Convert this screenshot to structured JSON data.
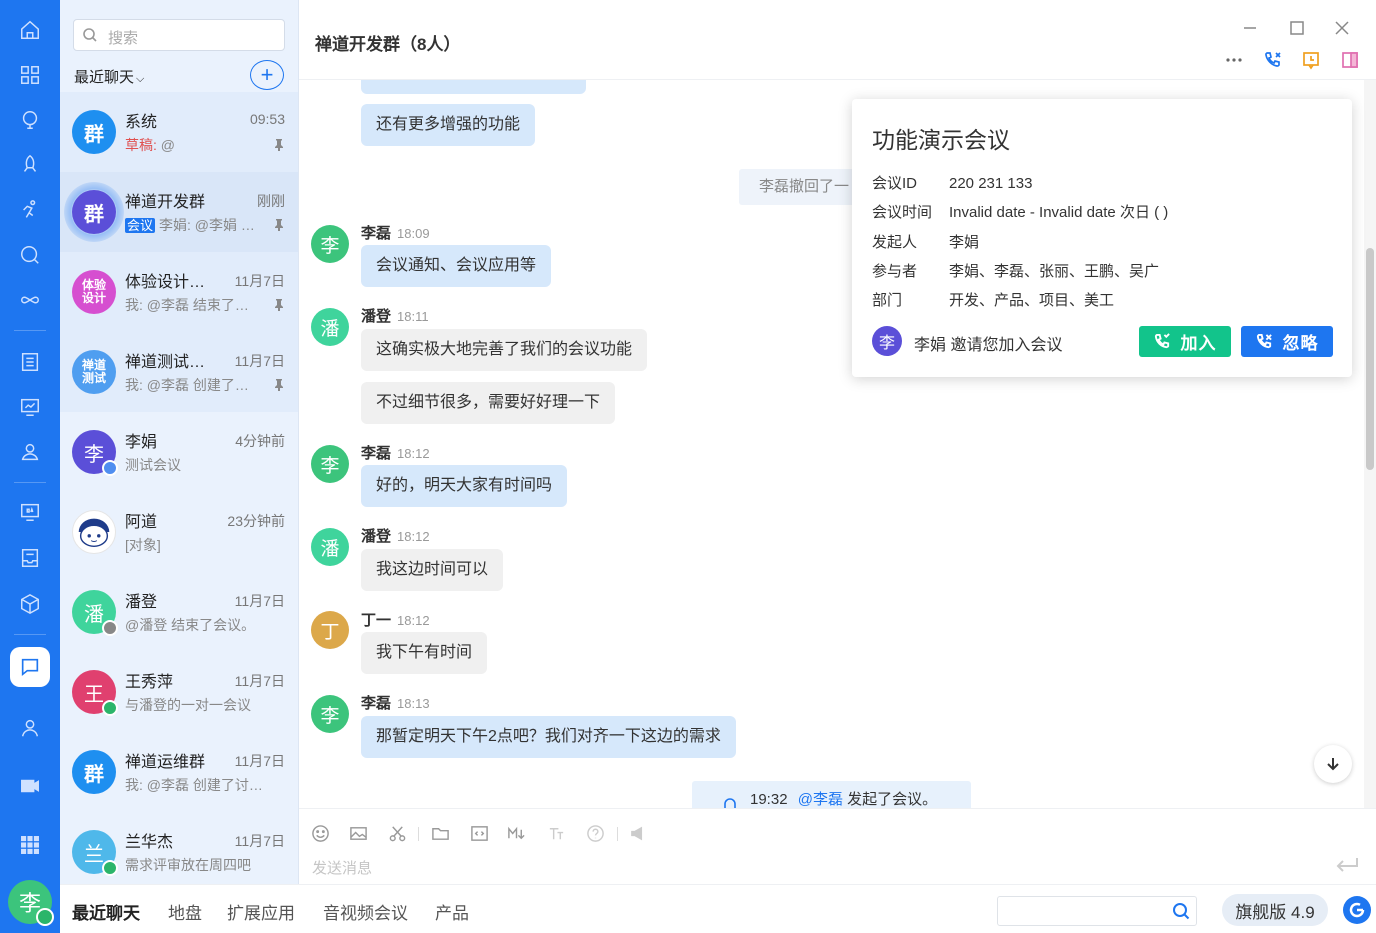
{
  "sidebar": {
    "search_placeholder": "搜索",
    "recent_label": "最近聊天",
    "add_label": "+",
    "conversations": [
      {
        "avatar": "群",
        "color": "#1e8ff0",
        "name": "系统",
        "time": "09:53",
        "draft": "草稿:",
        "preview": " @"
      },
      {
        "avatar": "群",
        "color": "#5b4fd8",
        "name": "禅道开发群",
        "time": "刚刚",
        "tag": "会议",
        "preview": "李娟: @李娟 …"
      },
      {
        "avatar": "体验设计",
        "color": "#d64fd0",
        "name": "体验设计…",
        "time": "11月7日",
        "preview": "我: @李磊 结束了…"
      },
      {
        "avatar": "禅道测试",
        "color": "#4f9ef0",
        "name": "禅道测试…",
        "time": "11月7日",
        "preview": "我: @李磊 创建了…"
      },
      {
        "avatar": "李",
        "color": "#5b4fd8",
        "name": "李娟",
        "time": "4分钟前",
        "preview": "测试会议"
      },
      {
        "avatar": "",
        "color": "#ffffff",
        "name": "阿道",
        "time": "23分钟前",
        "preview": "[对象]"
      },
      {
        "avatar": "潘",
        "color": "#3fd49c",
        "name": "潘登",
        "time": "11月7日",
        "preview": "@潘登 结束了会议。"
      },
      {
        "avatar": "王",
        "color": "#e0406f",
        "name": "王秀萍",
        "time": "11月7日",
        "preview": "与潘登的一对一会议"
      },
      {
        "avatar": "群",
        "color": "#1e8ff0",
        "name": "禅道运维群",
        "time": "11月7日",
        "preview": "我: @李磊 创建了讨…"
      },
      {
        "avatar": "兰",
        "color": "#4fb8ea",
        "name": "兰华杰",
        "time": "11月7日",
        "preview": "需求评审放在周四吧"
      }
    ]
  },
  "header": {
    "title": "禅道开发群（8人）"
  },
  "messages": {
    "bubble_1": "还有更多增强的功能",
    "recall_note": "李磊撤回了一",
    "m1": {
      "avatar": "李",
      "name": "李磊",
      "time": "18:09",
      "text": "会议通知、会议应用等"
    },
    "m2": {
      "avatar": "潘",
      "name": "潘登",
      "time": "18:11",
      "text": "这确实极大地完善了我们的会议功能",
      "text2": "不过细节很多，需要好好理一下"
    },
    "m3": {
      "avatar": "李",
      "name": "李磊",
      "time": "18:12",
      "text": "好的，明天大家有时间吗"
    },
    "m4": {
      "avatar": "潘",
      "name": "潘登",
      "time": "18:12",
      "text": "我这边时间可以"
    },
    "m5": {
      "avatar": "丁",
      "name": "丁一",
      "time": "18:12",
      "text": "我下午有时间"
    },
    "m6": {
      "avatar": "李",
      "name": "李磊",
      "time": "18:13",
      "text": "那暂定明天下午2点吧？我们对齐一下这边的需求"
    },
    "meeting_note": {
      "time": "19:32",
      "mention": "@李磊",
      "text": " 发起了会议。"
    }
  },
  "popup": {
    "title": "功能演示会议",
    "rows": [
      {
        "k": "会议ID",
        "v": "220 231 133"
      },
      {
        "k": "会议时间",
        "v": "Invalid date - Invalid date 次日 (  )"
      },
      {
        "k": "发起人",
        "v": "李娟"
      },
      {
        "k": "参与者",
        "v": "李娟、李磊、张丽、王鹏、吴广"
      },
      {
        "k": "部门",
        "v": "开发、产品、项目、美工"
      }
    ],
    "inviter_avatar": "李",
    "invite_text": "李娟 邀请您加入会议",
    "join_label": "加入",
    "ignore_label": "忽略"
  },
  "composer": {
    "placeholder": "发送消息"
  },
  "bottom": {
    "tabs": [
      "最近聊天",
      "地盘",
      "扩展应用",
      "音视频会议",
      "产品"
    ],
    "version": "旗舰版 4.9"
  },
  "user": {
    "avatar": "李"
  }
}
